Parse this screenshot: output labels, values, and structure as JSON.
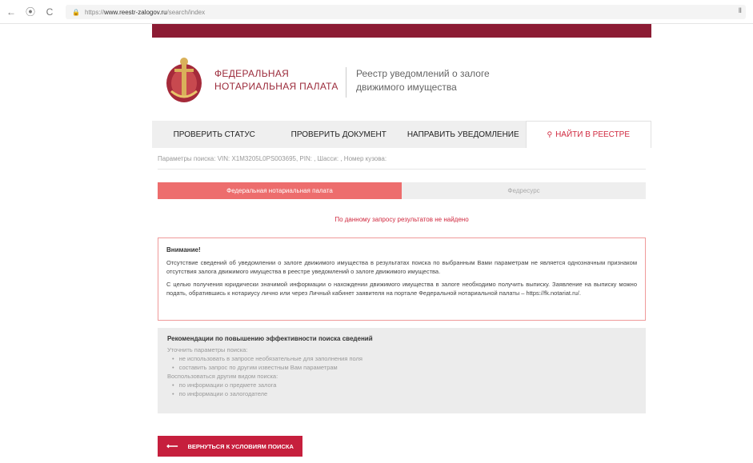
{
  "browser": {
    "back_icon": "←",
    "forward_icon": "⦿",
    "reload_icon": "C",
    "url_prefix": "https://",
    "url_host": "www.reestr-zalogov.ru",
    "url_path": "/search/index",
    "bookmark_icon": "Ⅱ"
  },
  "header": {
    "org_line1": "ФЕДЕРАЛЬНАЯ",
    "org_line2": "НОТАРИАЛЬНАЯ ПАЛАТА",
    "registry_line1": "Реестр уведомлений о залоге",
    "registry_line2": "движимого имущества"
  },
  "tabs": [
    {
      "label": "ПРОВЕРИТЬ СТАТУС"
    },
    {
      "label": "ПРОВЕРИТЬ ДОКУМЕНТ"
    },
    {
      "label": "НАПРАВИТЬ УВЕДОМЛЕНИЕ"
    },
    {
      "label": "НАЙТИ В РЕЕСТРЕ",
      "active": true
    }
  ],
  "params_text": "Параметры поиска: VIN: X1M3205L0PS003695, PIN: , Шасси: , Номер кузова:",
  "source_tabs": [
    {
      "label": "Федеральная нотариальная палата"
    },
    {
      "label": "Федресурс"
    }
  ],
  "no_results": "По данному запросу результатов не найдено",
  "warning": {
    "title": "Внимание!",
    "p1": "Отсутствие сведений об уведомлении о залоге движимого имущества в результатах поиска по выбранным Вами параметрам не является однозначным признаком отсутствия залога движимого имущества в реестре уведомлений о залоге движимого имущества.",
    "p2": "С целью получения юридически значимой информации о нахождении движимого имущества в залоге необходимо получить выписку. Заявление на выписку можно подать, обратившись к нотариусу лично или через Личный кабинет заявителя на портале Федеральной нотариальной палаты – https://fk.notariat.ru/."
  },
  "recommendations": {
    "title": "Рекомендации по повышению эффективности поиска сведений",
    "intro1": "Уточнить параметры поиска:",
    "items1": [
      "не использовать в запросе необязательные для заполнения поля",
      "составить запрос по другим известным Вам параметрам"
    ],
    "intro2": "Воспользоваться другим видом поиска:",
    "items2": [
      "по информации о предмете залога",
      "по информации о залогодателе"
    ]
  },
  "back_button": {
    "arrow": "⟵",
    "label": "ВЕРНУТЬСЯ К УСЛОВИЯМ ПОИСКА"
  },
  "colors": {
    "brand_dark": "#8c1c34",
    "accent_red": "#d0293f",
    "source_tab_active": "#ed6d6d"
  }
}
